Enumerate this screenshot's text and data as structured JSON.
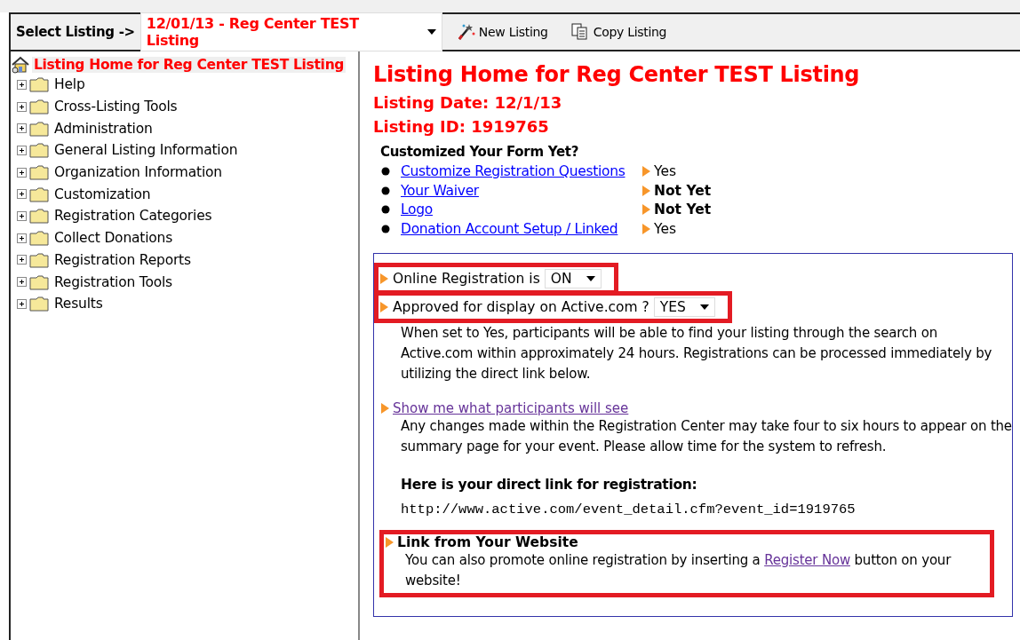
{
  "toolbar": {
    "select_label": "Select Listing ->",
    "listing": "12/01/13 - Reg Center TEST Listing",
    "buttons": [
      "New Listing",
      "Copy Listing"
    ]
  },
  "tree": {
    "root": {
      "label": "Listing Home for Reg Center TEST Listing",
      "selected": true
    },
    "items": [
      {
        "label": "Help",
        "expanded": false
      },
      {
        "label": "Cross-Listing Tools",
        "expanded": false
      },
      {
        "label": "Administration",
        "expanded": false
      },
      {
        "label": "General Listing Information",
        "expanded": false
      },
      {
        "label": "Organization Information",
        "expanded": false
      },
      {
        "label": "Customization",
        "expanded": false
      },
      {
        "label": "Registration Categories",
        "expanded": false
      },
      {
        "label": "Collect Donations",
        "expanded": false
      },
      {
        "label": "Registration Reports",
        "expanded": false
      },
      {
        "label": "Registration Tools",
        "expanded": false
      },
      {
        "label": "Results",
        "expanded": false
      }
    ]
  },
  "main": {
    "title": "Listing Home for Reg Center TEST Listing",
    "date": "Listing Date: 12/1/13",
    "id": "Listing ID: 1919765",
    "checklist_title": "Customized Your Form Yet?",
    "checklist": [
      {
        "link": "Customize Registration Questions",
        "status": "Yes",
        "done": true
      },
      {
        "link": "Your Waiver",
        "status": "Not Yet",
        "done": false
      },
      {
        "link": "Logo",
        "status": "Not Yet",
        "done": false
      },
      {
        "link": "Donation Account Setup / Linked",
        "status": "Yes",
        "done": true
      }
    ],
    "settings": [
      {
        "label": "Online Registration is",
        "value": "ON",
        "highlighted": true
      },
      {
        "label": "Approved for display on Active.com ?",
        "value": "YES",
        "highlighted": true
      }
    ],
    "approval_note": "When set to Yes, participants will be able to find your listing through the search on Active.com within approximately 24 hours. Registrations can be processed immediately by utilizing the direct link below.",
    "preview_link": "Show me what participants will see",
    "preview_note": "Any changes made within the Registration Center may take four to six hours to appear on the summary page for your event. Please allow time for the system to refresh.",
    "direct_link_title": "Here is your direct link for registration:",
    "direct_link": "http://www.active.com/event_detail.cfm?event_id=1919765",
    "website": {
      "title": "Link from Your Website",
      "text_before": "You can also promote online registration by inserting a",
      "link": "Register Now",
      "text_after": "button on your website!",
      "highlighted": true
    }
  }
}
